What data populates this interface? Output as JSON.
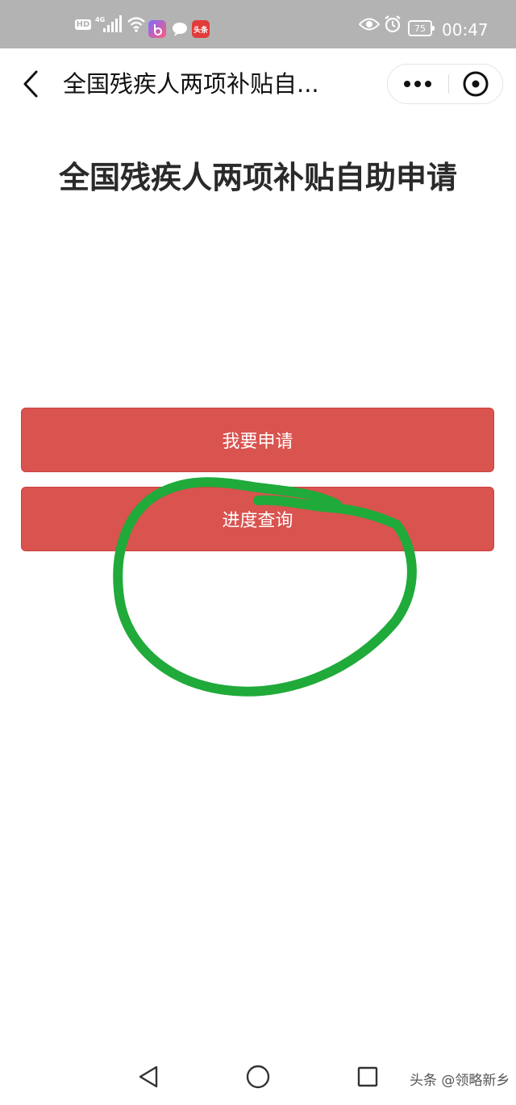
{
  "status_bar": {
    "hd_label": "HD",
    "network_label": "4G",
    "toutiao_badge": "头条",
    "battery_level": "75",
    "time": "00:47"
  },
  "title_bar": {
    "title": "全国残疾人两项补贴自...",
    "icons": {
      "back": "chevron-left-icon",
      "more": "more-dots-icon",
      "close": "close-circle-icon"
    }
  },
  "main": {
    "title": "全国残疾人两项补贴自助申请",
    "buttons": {
      "apply": "我要申请",
      "query": "进度查询"
    },
    "annotation_color": "#1faa3a",
    "button_color": "#d9534f"
  },
  "nav_bar": {
    "watermark": "头条 @领略新乡"
  }
}
